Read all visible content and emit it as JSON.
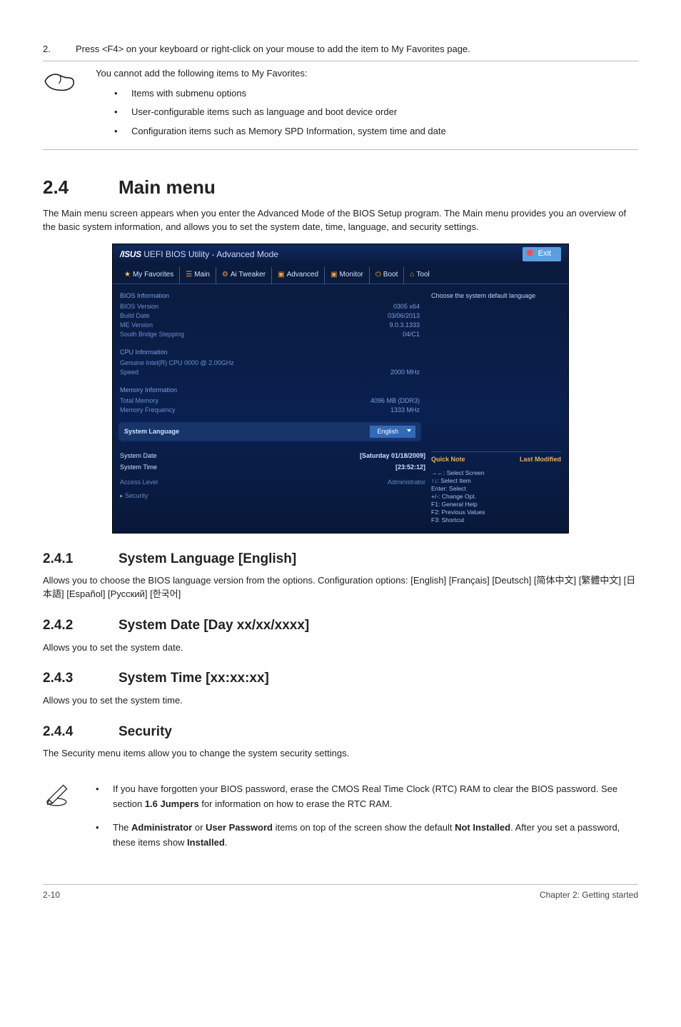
{
  "step": {
    "num": "2.",
    "text": "Press <F4> on your keyboard or right-click on your mouse to add the item to My Favorites page."
  },
  "note1": {
    "lead": "You cannot add the following items to My Favorites:",
    "items": [
      "Items with submenu options",
      "User-configurable items such as language and boot device order",
      "Configuration items such as Memory SPD Information, system time and date"
    ]
  },
  "section": {
    "num": "2.4",
    "title": "Main menu"
  },
  "section_intro": "The Main menu screen appears when you enter the Advanced Mode of the BIOS Setup program. The Main menu provides you an overview of the basic system information, and allows you to set the system date, time, language, and security settings.",
  "bios": {
    "brand": "/ISUS",
    "title": "UEFI BIOS Utility - Advanced Mode",
    "exit": "Exit",
    "tabs": [
      "My Favorites",
      "Main",
      "Ai Tweaker",
      "Advanced",
      "Monitor",
      "Boot",
      "Tool"
    ],
    "tabicons": [
      "★",
      "☰",
      "⚙",
      "▣",
      "▣",
      "⏻",
      "⌂"
    ],
    "right_hint": "Choose the system default language",
    "groups": [
      {
        "head": "BIOS Information",
        "rows": [
          {
            "k": "BIOS Version",
            "v": "0305 x64"
          },
          {
            "k": "Build Date",
            "v": "03/06/2013"
          },
          {
            "k": "ME Version",
            "v": "9.0.3.1333"
          },
          {
            "k": "South Bridge Stepping",
            "v": "04/C1"
          }
        ]
      },
      {
        "head": "CPU Information",
        "rows": [
          {
            "k": "Genuine Intel(R) CPU 0000 @ 2.00GHz",
            "v": ""
          },
          {
            "k": "Speed",
            "v": "2000 MHz"
          }
        ]
      },
      {
        "head": "Memory Information",
        "rows": [
          {
            "k": "Total Memory",
            "v": "4096 MB (DDR3)"
          },
          {
            "k": "Memory Frequency",
            "v": "1333 MHz"
          }
        ]
      }
    ],
    "lang_label": "System Language",
    "lang_value": "English",
    "date_label": "System Date",
    "date_value": "[Saturday 01/18/2009]",
    "time_label": "System Time",
    "time_value": "[23:52:12]",
    "access_label": "Access Level",
    "access_value": "Administrator",
    "security": "Security",
    "quick": "Quick Note",
    "lastmod": "Last Modified",
    "help": [
      "→←: Select Screen",
      "↑↓: Select Item",
      "Enter: Select",
      "+/-: Change Opt.",
      "F1: General Help",
      "F2: Previous Values",
      "F3: Shortcut"
    ]
  },
  "s241": {
    "num": "2.4.1",
    "title": "System Language [English]",
    "text": "Allows you to choose the BIOS language version from the options. Configuration options: [English] [Français] [Deutsch] [简体中文] [繁體中文] [日本語] [Español] [Русский] [한국어]"
  },
  "s242": {
    "num": "2.4.2",
    "title": "System Date [Day xx/xx/xxxx]",
    "text": "Allows you to set the system date."
  },
  "s243": {
    "num": "2.4.3",
    "title": "System Time [xx:xx:xx]",
    "text": "Allows you to set the system time."
  },
  "s244": {
    "num": "2.4.4",
    "title": "Security",
    "text": "The Security menu items allow you to change the system security settings."
  },
  "note2": {
    "items": [
      "If you have forgotten your BIOS password, erase the CMOS Real Time Clock (RTC) RAM to clear the BIOS password. See section 1.6 Jumpers for information on how to erase the RTC RAM.",
      "The Administrator or User Password items on top of the screen show the default Not Installed. After you set a password, these items show Installed."
    ],
    "item2_html": "The <b>Administrator</b> or <b>User Password</b> items on top of the screen show the default <b>Not Installed</b>. After you set a password, these items show <b>Installed</b>."
  },
  "footer": {
    "page": "2-10",
    "chapter": "Chapter 2: Getting started"
  },
  "chart_data": null
}
